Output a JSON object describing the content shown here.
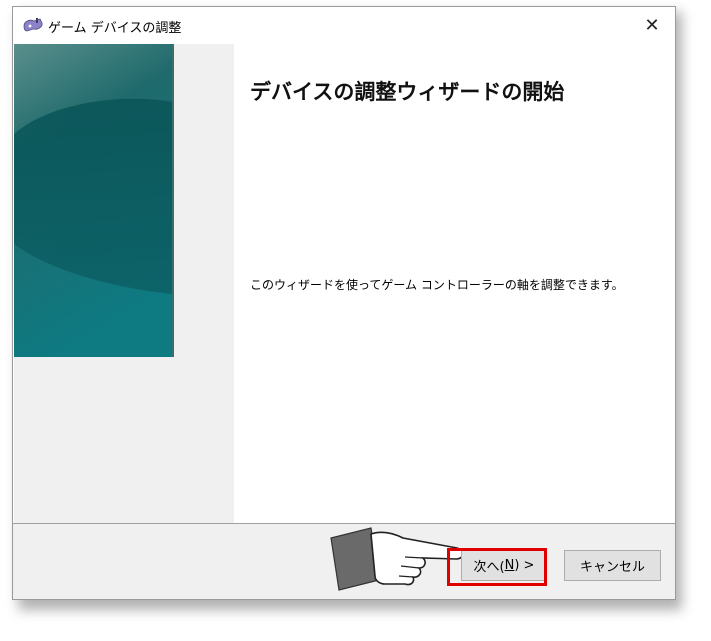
{
  "window": {
    "title": "ゲーム デバイスの調整",
    "close_glyph": "✕"
  },
  "content": {
    "heading": "デバイスの調整ウィザードの開始",
    "description": "このウィザードを使ってゲーム コントローラーの軸を調整できます。"
  },
  "buttons": {
    "next_prefix": "次へ(",
    "next_mnemonic": "N",
    "next_suffix": ") >",
    "cancel": "キャンセル"
  },
  "colors": {
    "highlight": "#e00000",
    "banner_top": "#4d8a87",
    "banner_bottom": "#0d7880"
  },
  "icons": {
    "title": "joystick-icon",
    "close": "close-icon",
    "pointer": "pointing-hand-icon"
  }
}
